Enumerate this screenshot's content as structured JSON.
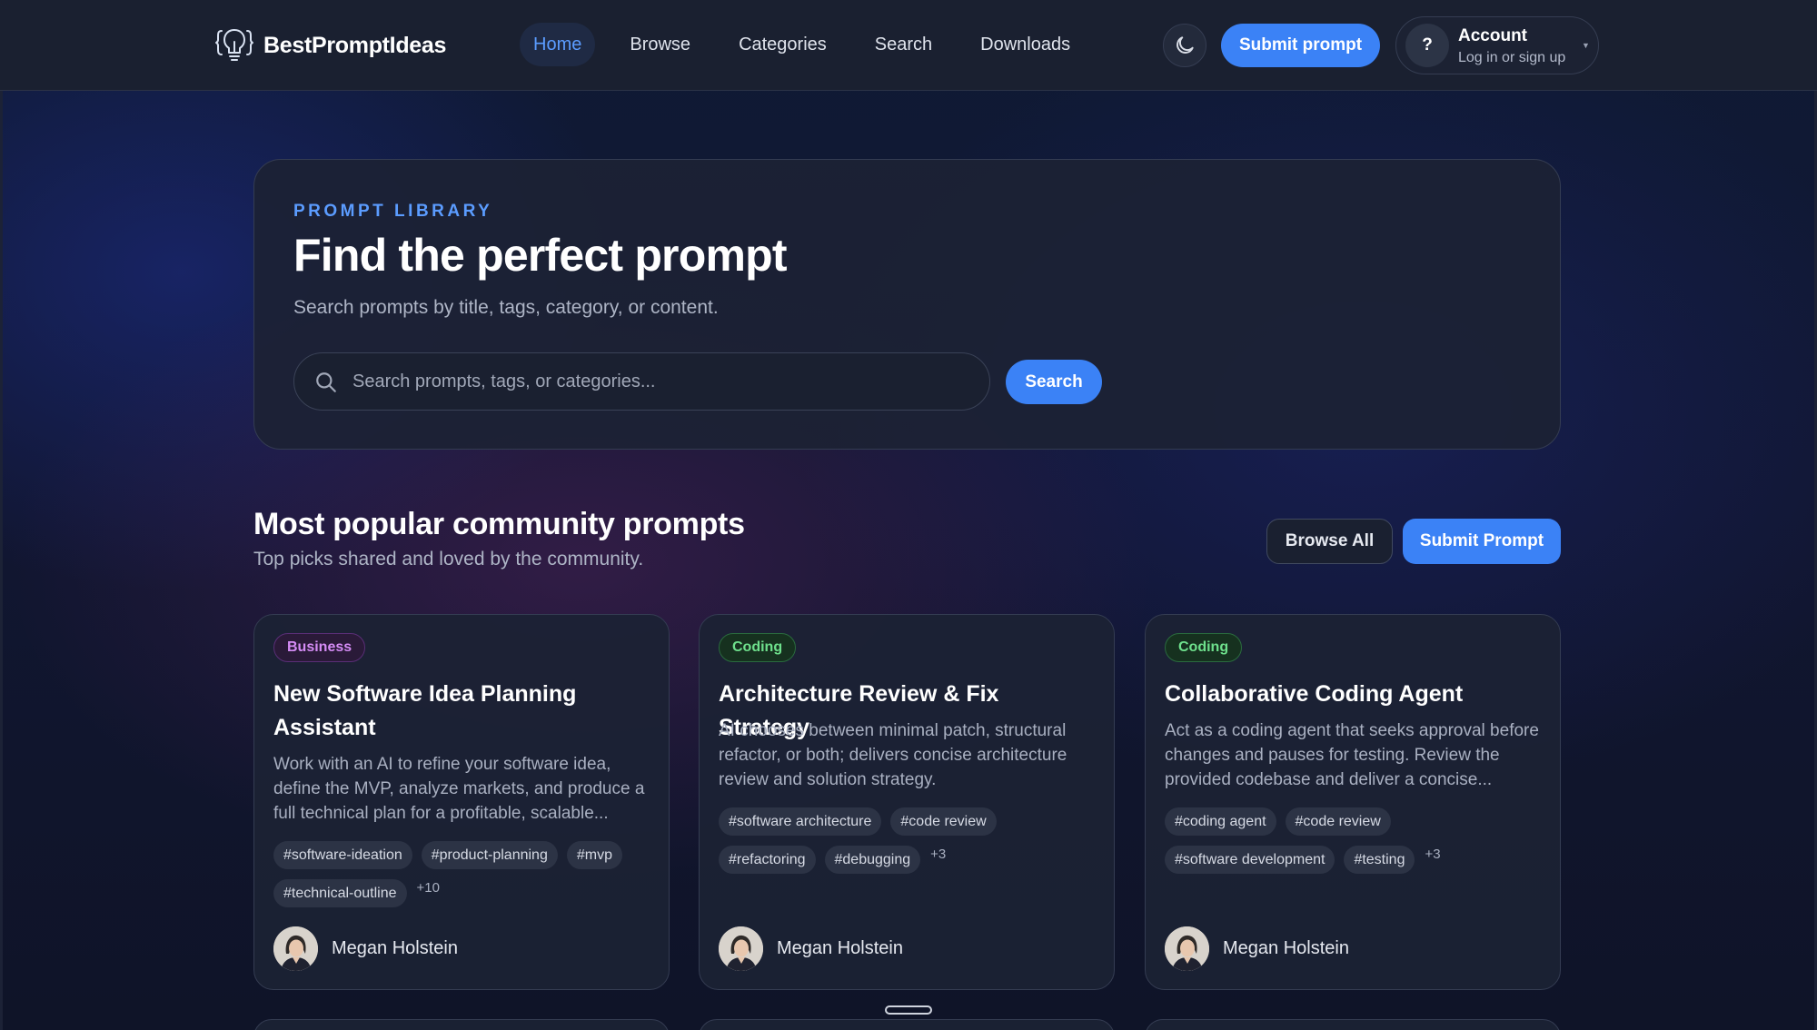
{
  "brand": {
    "name": "BestPromptIdeas",
    "accent": "#3b82f6"
  },
  "nav": {
    "links": [
      "Home",
      "Browse",
      "Categories",
      "Search",
      "Downloads"
    ],
    "active": "Home",
    "submit_label": "Submit prompt",
    "account": {
      "initial": "?",
      "title": "Account",
      "subtitle": "Log in or sign up"
    }
  },
  "hero": {
    "eyebrow": "PROMPT LIBRARY",
    "title": "Find the perfect prompt",
    "subtitle": "Search prompts by title, tags, category, or content.",
    "search_placeholder": "Search prompts, tags, or categories...",
    "search_value": "",
    "search_button": "Search"
  },
  "section": {
    "title": "Most popular community prompts",
    "subtitle": "Top picks shared and loved by the community.",
    "browse_all": "Browse All",
    "submit": "Submit Prompt"
  },
  "cards": [
    {
      "category": "Business",
      "title": "New Software Idea Planning Assistant",
      "description": "Work with an AI to refine your software idea, define the MVP, analyze markets, and produce a full technical plan for a profitable, scalable...",
      "tags": [
        "#software-ideation",
        "#product-planning",
        "#mvp",
        "#technical-outline"
      ],
      "more": "+10",
      "author": "Megan Holstein"
    },
    {
      "category": "Coding",
      "title": "Architecture Review & Fix Strategy",
      "description": "AI chooses between minimal patch, structural refactor, or both; delivers concise architecture review and solution strategy.",
      "tags": [
        "#software architecture",
        "#code review",
        "#refactoring",
        "#debugging"
      ],
      "more": "+3",
      "author": "Megan Holstein"
    },
    {
      "category": "Coding",
      "title": "Collaborative Coding Agent",
      "description": "Act as a coding agent that seeks approval before changes and pauses for testing. Review the provided codebase and deliver a concise...",
      "tags": [
        "#coding agent",
        "#code review",
        "#software development",
        "#testing"
      ],
      "more": "+3",
      "author": "Megan Holstein"
    }
  ],
  "icons": {
    "logo": "lightbulb-brackets-icon",
    "theme": "moon-icon",
    "search": "search-icon",
    "avatar": "user-avatar"
  }
}
